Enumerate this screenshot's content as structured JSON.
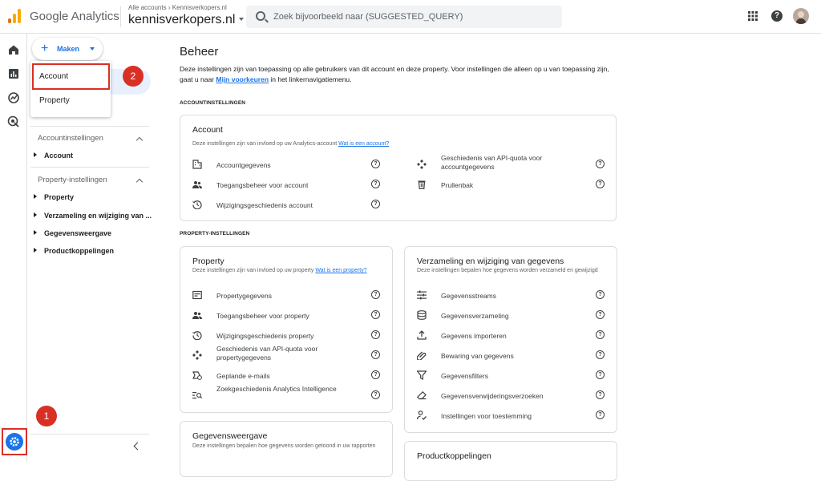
{
  "topbar": {
    "product_name": "Google Analytics",
    "breadcrumb_root": "Alle accounts",
    "breadcrumb_sep": "›",
    "breadcrumb_account": "Kennisverkopers.nl",
    "account_name": "kennisverkopers.nl",
    "search_placeholder": "Zoek bijvoorbeeld naar (SUGGESTED_QUERY)"
  },
  "panel": {
    "create_label": "Maken",
    "menu": [
      "Account",
      "Property"
    ],
    "sections": [
      {
        "title": "Accountinstellingen",
        "items": [
          "Account"
        ]
      },
      {
        "title": "Property-instellingen",
        "items": [
          "Property",
          "Verzameling en wijziging van ...",
          "Gegevensweergave",
          "Productkoppelingen"
        ]
      }
    ]
  },
  "annotations": {
    "badge1": "1",
    "badge2": "2",
    "highlight_color": "#d93025"
  },
  "main": {
    "title": "Beheer",
    "intro_text": "Deze instellingen zijn van toepassing op alle gebruikers van dit account en deze property. Voor instellingen die alleen op u van toepassing zijn, gaat u naar ",
    "intro_link": "Mijn voorkeuren",
    "intro_suffix": " in het linkernavigatiemenu.",
    "account_section": "ACCOUNTINSTELLINGEN",
    "property_section": "PROPERTY-INSTELLINGEN",
    "account_card": {
      "title": "Account",
      "desc": "Deze instellingen zijn van invloed op uw Analytics-account ",
      "desc_link": "Wat is een account?",
      "left": [
        {
          "icon": "building-icon",
          "label": "Accountgegevens"
        },
        {
          "icon": "people-icon",
          "label": "Toegangsbeheer voor account"
        },
        {
          "icon": "history-icon",
          "label": "Wijzigingsgeschiedenis account"
        }
      ],
      "right": [
        {
          "icon": "api-icon",
          "label": "Geschiedenis van API-quota voor accountgegevens"
        },
        {
          "icon": "trash-icon",
          "label": "Prullenbak"
        }
      ]
    },
    "property_card": {
      "title": "Property",
      "desc": "Deze instellingen zijn van invloed op uw property ",
      "desc_link": "Wat is een property?",
      "rows": [
        {
          "icon": "property-details-icon",
          "label": "Propertygegevens"
        },
        {
          "icon": "people-icon",
          "label": "Toegangsbeheer voor property"
        },
        {
          "icon": "history-icon",
          "label": "Wijzigingsgeschiedenis property"
        },
        {
          "icon": "api-icon",
          "label": "Geschiedenis van API-quota voor propertygegevens"
        },
        {
          "icon": "scheduled-email-icon",
          "label": "Geplande e-mails"
        },
        {
          "icon": "search-history-icon",
          "label": "Zoekgeschiedenis Analytics Intelligence"
        }
      ]
    },
    "collection_card": {
      "title": "Verzameling en wijziging van gegevens",
      "desc": "Deze instellingen bepalen hoe gegevens worden verzameld en gewijzigd",
      "rows": [
        {
          "icon": "streams-icon",
          "label": "Gegevensstreams"
        },
        {
          "icon": "database-icon",
          "label": "Gegevensverzameling"
        },
        {
          "icon": "upload-icon",
          "label": "Gegevens importeren"
        },
        {
          "icon": "retention-icon",
          "label": "Bewaring van gegevens"
        },
        {
          "icon": "filter-icon",
          "label": "Gegevensfilters"
        },
        {
          "icon": "eraser-icon",
          "label": "Gegevensverwijderingsverzoeken"
        },
        {
          "icon": "consent-icon",
          "label": "Instellingen voor toestemming"
        }
      ]
    },
    "display_card": {
      "title": "Gegevensweergave",
      "desc": "Deze instellingen bepalen hoe gegevens worden getoond in uw rapporten"
    },
    "links_card": {
      "title": "Productkoppelingen"
    },
    "help_glyph": "?"
  }
}
